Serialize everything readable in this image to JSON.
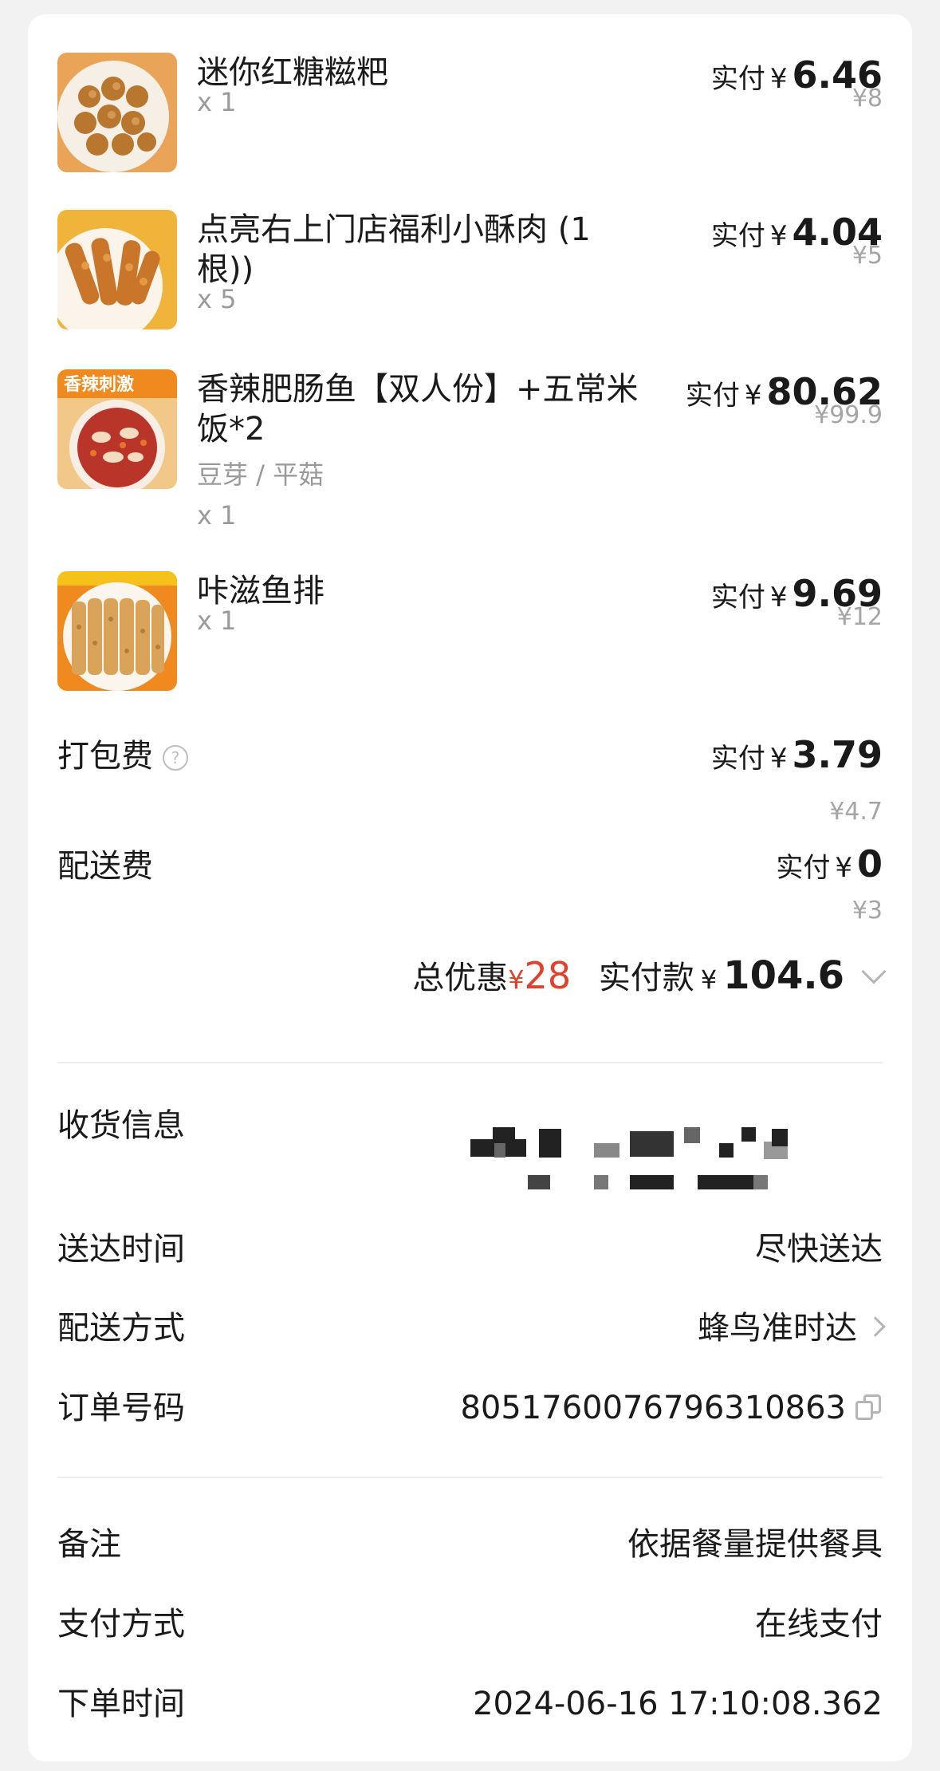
{
  "items": [
    {
      "name": "迷你红糖糍粑",
      "qty": "x 1",
      "pay_label": "实付",
      "currency": "¥",
      "price": "6.46",
      "original": "¥8",
      "image": "fried-dough-balls-photo"
    },
    {
      "name": "点亮右上门店福利小酥肉 (1根))",
      "qty": "x 5",
      "pay_label": "实付",
      "currency": "¥",
      "price": "4.04",
      "original": "¥5",
      "image": "crispy-pork-photo"
    },
    {
      "name": "香辣肥肠鱼【双人份】+五常米饭*2",
      "spec": "豆芽 / 平菇",
      "qty": "x 1",
      "pay_label": "实付",
      "currency": "¥",
      "price": "80.62",
      "original": "¥99.9",
      "image": "spicy-fish-photo",
      "badge": "香辣刺激"
    },
    {
      "name": "咔滋鱼排",
      "qty": "x 1",
      "pay_label": "实付",
      "currency": "¥",
      "price": "9.69",
      "original": "¥12",
      "image": "fish-fillet-photo"
    }
  ],
  "fees": {
    "packing": {
      "label": "打包费",
      "pay_label": "实付",
      "currency": "¥",
      "price": "3.79",
      "original": "¥4.7",
      "help_icon": "question-circle-icon"
    },
    "delivery": {
      "label": "配送费",
      "pay_label": "实付",
      "currency": "¥",
      "price": "0",
      "original": "¥3"
    }
  },
  "summary": {
    "discount_label": "总优惠",
    "discount_currency": "¥",
    "discount_value": "28",
    "total_label": "实付款",
    "total_currency": "¥",
    "total_value": "104.6",
    "expand_icon": "chevron-down-icon"
  },
  "info": {
    "address_label": "收货信息",
    "delivery_time_label": "送达时间",
    "delivery_time_value": "尽快送达",
    "delivery_method_label": "配送方式",
    "delivery_method_value": "蜂鸟准时达",
    "order_number_label": "订单号码",
    "order_number_value": "8051760076796310863",
    "remark_label": "备注",
    "remark_value": "依据餐量提供餐具",
    "payment_label": "支付方式",
    "payment_value": "在线支付",
    "order_time_label": "下单时间",
    "order_time_value": "2024-06-16 17:10:08.362"
  },
  "colors": {
    "accent_red": "#e0402c",
    "muted_text": "#9a9a9a"
  }
}
